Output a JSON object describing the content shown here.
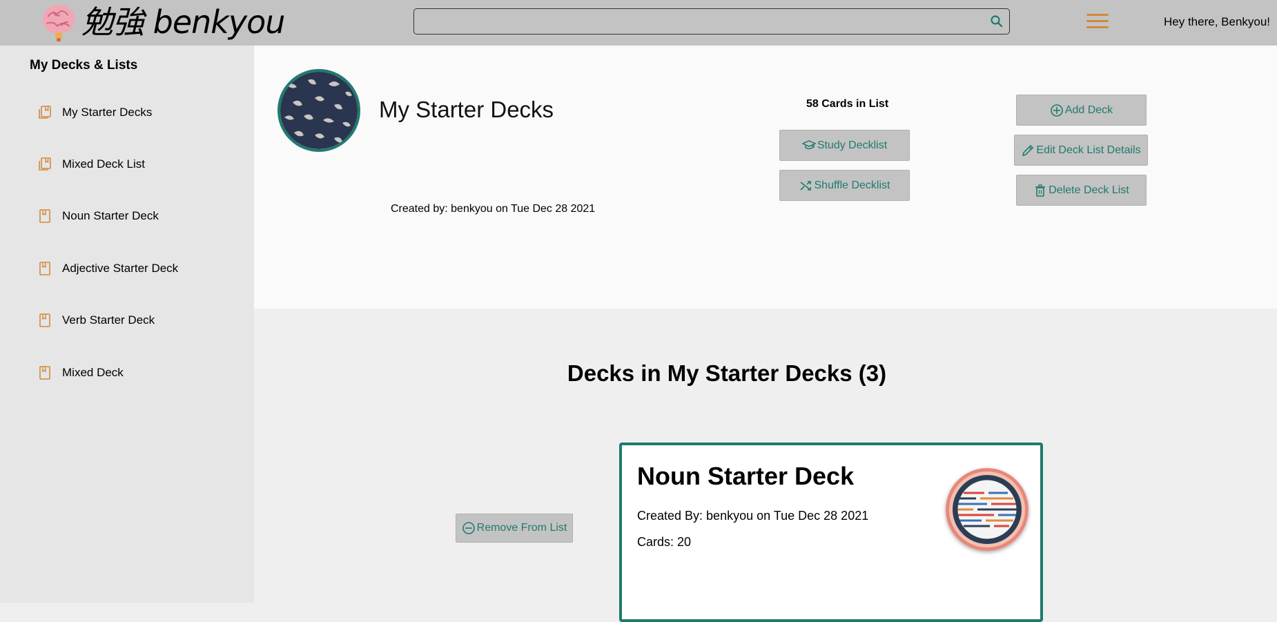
{
  "header": {
    "brand": "勉強 benkyou",
    "search_placeholder": "",
    "greeting": "Hey there, Benkyou!"
  },
  "sidebar": {
    "title": "My Decks & Lists",
    "items": [
      {
        "label": "My Starter Decks",
        "icon": "deck-list-icon"
      },
      {
        "label": "Mixed Deck List",
        "icon": "deck-list-icon"
      },
      {
        "label": "Noun Starter Deck",
        "icon": "deck-icon"
      },
      {
        "label": "Adjective Starter Deck",
        "icon": "deck-icon"
      },
      {
        "label": "Verb Starter Deck",
        "icon": "deck-icon"
      },
      {
        "label": "Mixed Deck",
        "icon": "deck-icon"
      }
    ]
  },
  "list": {
    "title": "My Starter Decks",
    "created": "Created by: benkyou on Tue Dec 28 2021",
    "cards_count": "58 Cards in List",
    "study_label": "Study Decklist",
    "shuffle_label": "Shuffle Decklist",
    "add_label": "Add Deck",
    "edit_label": "Edit Deck List Details",
    "delete_label": "Delete Deck List"
  },
  "decks_section": {
    "heading": "Decks in My Starter Decks (3)",
    "remove_label": "Remove From List",
    "decks": [
      {
        "title": "Noun Starter Deck",
        "created": "Created By: benkyou on Tue Dec 28 2021",
        "cards": "Cards: 20"
      }
    ]
  },
  "colors": {
    "accent": "#1f7a6e",
    "icon_orange": "#d08a3c",
    "header_bg": "#c3c3c3",
    "sidebar_bg": "#e6e6e6"
  }
}
